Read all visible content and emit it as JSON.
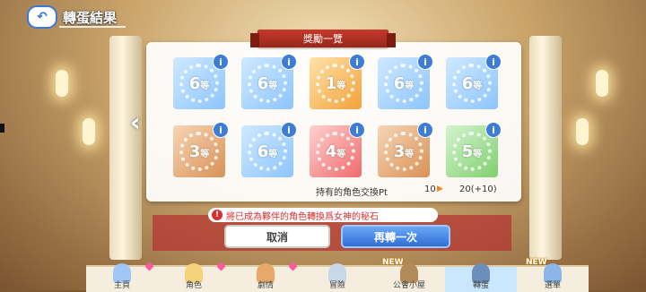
{
  "header": {
    "back_icon": "back-arrow-icon",
    "title": "轉蛋結果"
  },
  "panel": {
    "ribbon_title": "獎勵一覽",
    "rewards": [
      {
        "rank": "6",
        "suffix": "等",
        "color": "blue"
      },
      {
        "rank": "6",
        "suffix": "等",
        "color": "blue"
      },
      {
        "rank": "1",
        "suffix": "等",
        "color": "gold"
      },
      {
        "rank": "6",
        "suffix": "等",
        "color": "blue"
      },
      {
        "rank": "6",
        "suffix": "等",
        "color": "blue"
      },
      {
        "rank": "3",
        "suffix": "等",
        "color": "bronze"
      },
      {
        "rank": "6",
        "suffix": "等",
        "color": "blue"
      },
      {
        "rank": "4",
        "suffix": "等",
        "color": "red"
      },
      {
        "rank": "3",
        "suffix": "等",
        "color": "bronze"
      },
      {
        "rank": "5",
        "suffix": "等",
        "color": "green"
      }
    ],
    "info_label": "i",
    "pt_label": "持有的角色交換Pt",
    "pt_current": "10",
    "pt_after": "20(+10)"
  },
  "notice": {
    "icon": "!",
    "text": "將已成為夥伴的角色轉換爲女神的秘石"
  },
  "buttons": {
    "cancel": "取消",
    "again": "再轉一次"
  },
  "nav": {
    "items": [
      {
        "label": "主頁",
        "new": "",
        "diamond": true
      },
      {
        "label": "角色",
        "new": "",
        "diamond": true
      },
      {
        "label": "劇情",
        "new": "",
        "diamond": true
      },
      {
        "label": "冒險",
        "new": "",
        "diamond": false
      },
      {
        "label": "公會小屋",
        "new": "NEW",
        "diamond": false
      },
      {
        "label": "轉蛋",
        "new": "",
        "diamond": false,
        "active": true
      },
      {
        "label": "選單",
        "new": "NEW",
        "diamond": false
      }
    ]
  },
  "colors": {
    "accent": "#3b77d6",
    "notice_red": "#d52f2f",
    "ribbon_red": "#c53a2c"
  }
}
